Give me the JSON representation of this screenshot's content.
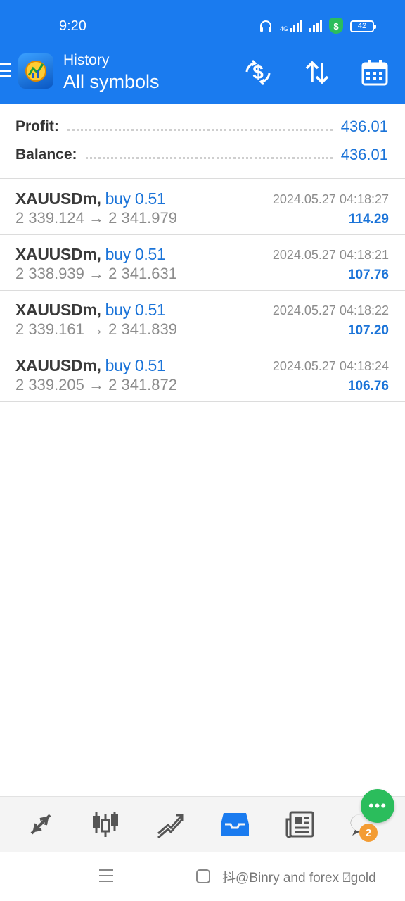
{
  "status_bar": {
    "time": "9:20",
    "network": "4G",
    "shield_glyph": "$",
    "battery": "42",
    "icons": [
      "headphones-icon",
      "signal-icon",
      "shield-icon",
      "battery-icon"
    ]
  },
  "app_bar": {
    "subtitle": "History",
    "title": "All symbols",
    "actions": [
      "dollar-exchange-icon",
      "sort-icon",
      "calendar-icon"
    ]
  },
  "summary": {
    "profit_label": "Profit:",
    "profit_value": "436.01",
    "balance_label": "Balance:",
    "balance_value": "436.01"
  },
  "deals": [
    {
      "symbol": "XAUUSDm,",
      "action": "buy 0.51",
      "open_price": "2 339.124",
      "arrow": "→",
      "close_price": "2 341.979",
      "time": "2024.05.27 04:18:27",
      "profit": "114.29"
    },
    {
      "symbol": "XAUUSDm,",
      "action": "buy 0.51",
      "open_price": "2 338.939",
      "arrow": "→",
      "close_price": "2 341.631",
      "time": "2024.05.27 04:18:21",
      "profit": "107.76"
    },
    {
      "symbol": "XAUUSDm,",
      "action": "buy 0.51",
      "open_price": "2 339.161",
      "arrow": "→",
      "close_price": "2 341.839",
      "time": "2024.05.27 04:18:22",
      "profit": "107.20"
    },
    {
      "symbol": "XAUUSDm,",
      "action": "buy 0.51",
      "open_price": "2 339.205",
      "arrow": "→",
      "close_price": "2 341.872",
      "time": "2024.05.27 04:18:24",
      "profit": "106.76"
    }
  ],
  "bottom_nav": {
    "items": [
      "quotes-icon",
      "chart-icon",
      "trade-icon",
      "history-icon",
      "news-icon",
      "messages-icon"
    ],
    "active": "history-icon",
    "messages_badge": "2",
    "chat_glyph": "•••"
  },
  "colors": {
    "header": "#1a7bef",
    "accent_blue": "#1a73d8",
    "chat_green": "#2bbd5c",
    "badge_orange": "#f39c33"
  },
  "watermark": "抖@Binry and forex ⍁gold"
}
